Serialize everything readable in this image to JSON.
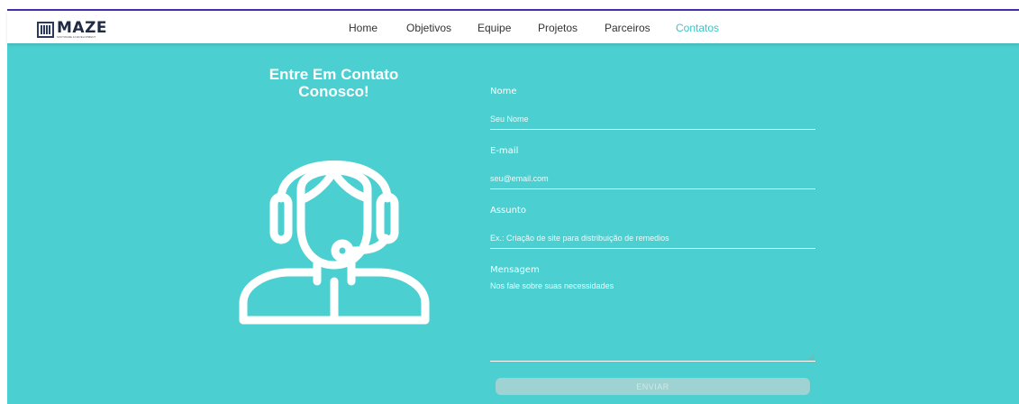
{
  "brand": {
    "name": "MAZE",
    "tagline": "SOFTWARE & DEVELOPMENT"
  },
  "nav": {
    "items": [
      {
        "label": "Home",
        "active": false
      },
      {
        "label": "Objetivos",
        "active": false
      },
      {
        "label": "Equipe",
        "active": false
      },
      {
        "label": "Projetos",
        "active": false
      },
      {
        "label": "Parceiros",
        "active": false
      },
      {
        "label": "Contatos",
        "active": true
      }
    ]
  },
  "contact": {
    "heading_line1": "Entre Em Contato",
    "heading_line2": "Conosco!",
    "illustration_icon": "headset-agent-icon"
  },
  "form": {
    "name_label": "Nome",
    "name_placeholder": "Seu Nome",
    "email_label": "E-mail",
    "email_placeholder": "seu@email.com",
    "subject_label": "Assunto",
    "subject_placeholder": "Ex.: Criação de site para distribuição de remedios",
    "message_label": "Mensagem",
    "message_placeholder": "Nos fale sobre suas necessidades",
    "submit_label": "ENVIAR"
  },
  "colors": {
    "background": "#4ccfd0",
    "accent": "#4a2cae",
    "active_nav": "#3cc6c8",
    "button": "#9fd3d3"
  }
}
